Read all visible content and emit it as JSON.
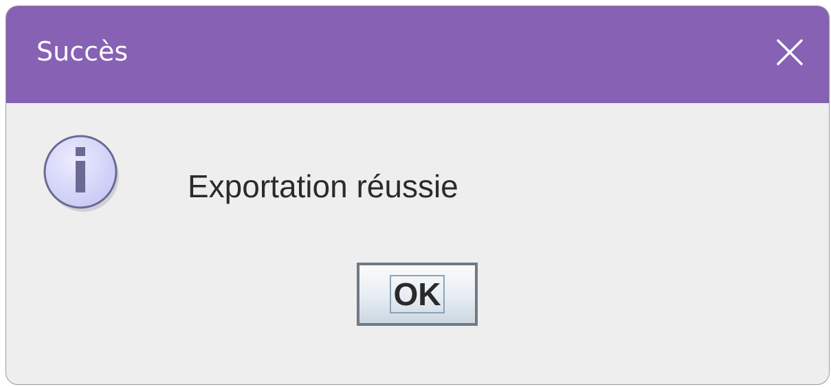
{
  "dialog": {
    "title": "Succès",
    "message": "Exportation réussie",
    "ok_label": "OK",
    "icons": {
      "close": "close-icon",
      "info": "info-icon"
    }
  },
  "colors": {
    "titlebar": "#8661b4",
    "title_text": "#ffffff",
    "body_background": "#eeeeee",
    "message_text": "#2a2a2a",
    "info_icon_fill": "#d4d4fb",
    "info_icon_mark": "#6a6a93"
  }
}
